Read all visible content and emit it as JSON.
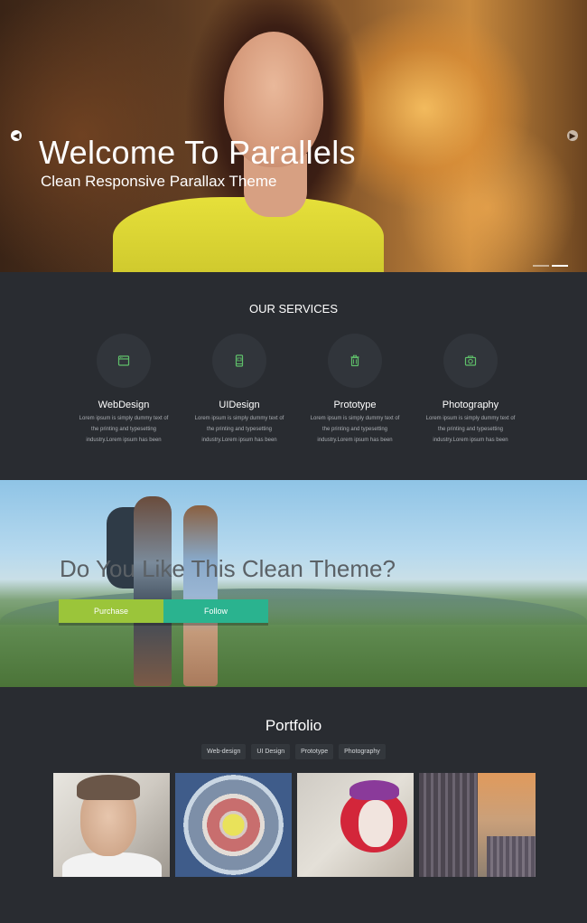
{
  "hero": {
    "title": "Welcome To Parallels",
    "subtitle": "Clean Responsive Parallax Theme",
    "prev_icon": "arrow-left-circle-icon",
    "next_icon": "arrow-right-circle-icon",
    "slides": 2,
    "active_slide": 2
  },
  "services": {
    "title": "OUR SERVICES",
    "accent_color": "#5fbf6a",
    "items": [
      {
        "name": "WebDesign",
        "icon": "browser-window-icon",
        "desc": "Lorem ipsum is simply dummy text of the printing and typesetting industry.Lorem ipsum has been"
      },
      {
        "name": "UIDesign",
        "icon": "mobile-phone-icon",
        "desc": "Lorem ipsum is simply dummy text of the printing and typesetting industry.Lorem ipsum has been"
      },
      {
        "name": "Prototype",
        "icon": "trash-bin-icon",
        "desc": "Lorem ipsum is simply dummy text of the printing and typesetting industry.Lorem ipsum has been"
      },
      {
        "name": "Photography",
        "icon": "camera-icon",
        "desc": "Lorem ipsum is simply dummy text of the printing and typesetting industry.Lorem ipsum has been"
      }
    ]
  },
  "cta": {
    "title": "Do You Like This Clean Theme?",
    "purchase_label": "Purchase",
    "follow_label": "Follow",
    "purchase_color": "#9bc53a",
    "follow_color": "#2ab38f"
  },
  "portfolio": {
    "title": "Portfolio",
    "filters": [
      "Web-design",
      "UI Design",
      "Prototype",
      "Photography"
    ]
  }
}
